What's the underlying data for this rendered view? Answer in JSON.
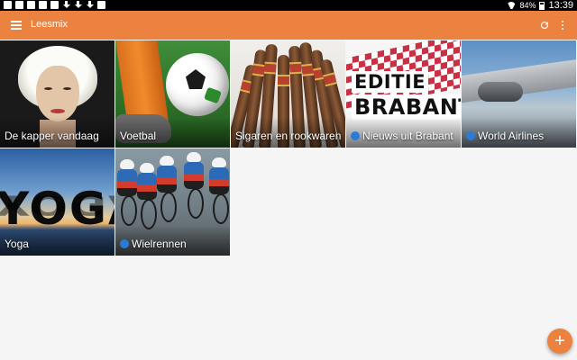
{
  "status_bar": {
    "left_icons": [
      "notification-icon",
      "notification-icon",
      "notification-icon",
      "notification-icon",
      "notification-icon",
      "download-icon",
      "download-icon",
      "download-icon",
      "camera-icon"
    ],
    "battery": "84%",
    "time": "13:39"
  },
  "app_bar": {
    "title": "Leesmix",
    "background": "#ec8240",
    "icons": [
      "menu-icon",
      "refresh-icon",
      "overflow-icon"
    ]
  },
  "tiles": [
    {
      "label": "De kapper vandaag",
      "has_dot": false
    },
    {
      "label": "Voetbal",
      "has_dot": false
    },
    {
      "label": "Sigaren en rookwaren",
      "has_dot": false
    },
    {
      "label": "Nieuws uit Brabant",
      "has_dot": true
    },
    {
      "label": "World Airlines",
      "has_dot": true
    },
    {
      "label": "Yoga",
      "has_dot": false
    },
    {
      "label": "Wielrennen",
      "has_dot": true
    }
  ],
  "tile_art": {
    "brabant_line1": "EDITIE",
    "brabant_line2": "BRABANT",
    "yoga_word": "YOGA"
  },
  "dot_color": "#2b7bd6",
  "fab": {
    "symbol": "+"
  }
}
